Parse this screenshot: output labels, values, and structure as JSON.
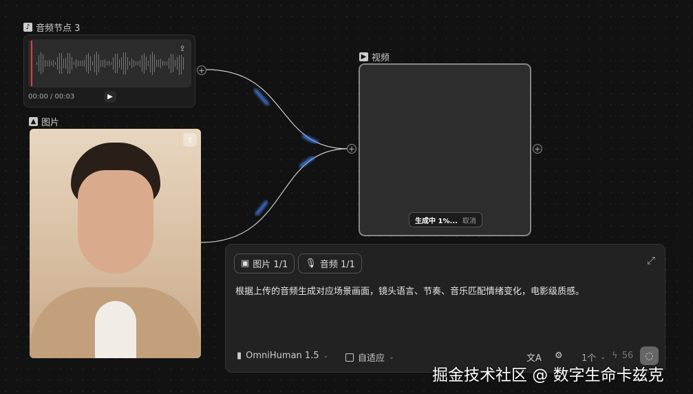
{
  "audio_node": {
    "title": "音频节点 3",
    "time": "00:00 / 00:03"
  },
  "image_node": {
    "title": "图片"
  },
  "video_node": {
    "title": "视频",
    "status": "生成中 1%...",
    "cancel": "取消"
  },
  "prompt": {
    "chips": [
      {
        "label": "图片 1/1"
      },
      {
        "label": "音频 1/1"
      }
    ],
    "text": "根据上传的音频生成对应场景画面，镜头语言、节奏、音乐匹配情绪变化，电影级质感。",
    "model": "OmniHuman 1.5",
    "ratio": "自适应",
    "count": "1个",
    "credits": "56"
  },
  "watermark": "掘金技术社区 @ 数字生命卡兹克",
  "colors": {
    "accent": "#4a8cff",
    "playhead": "#e04040"
  }
}
